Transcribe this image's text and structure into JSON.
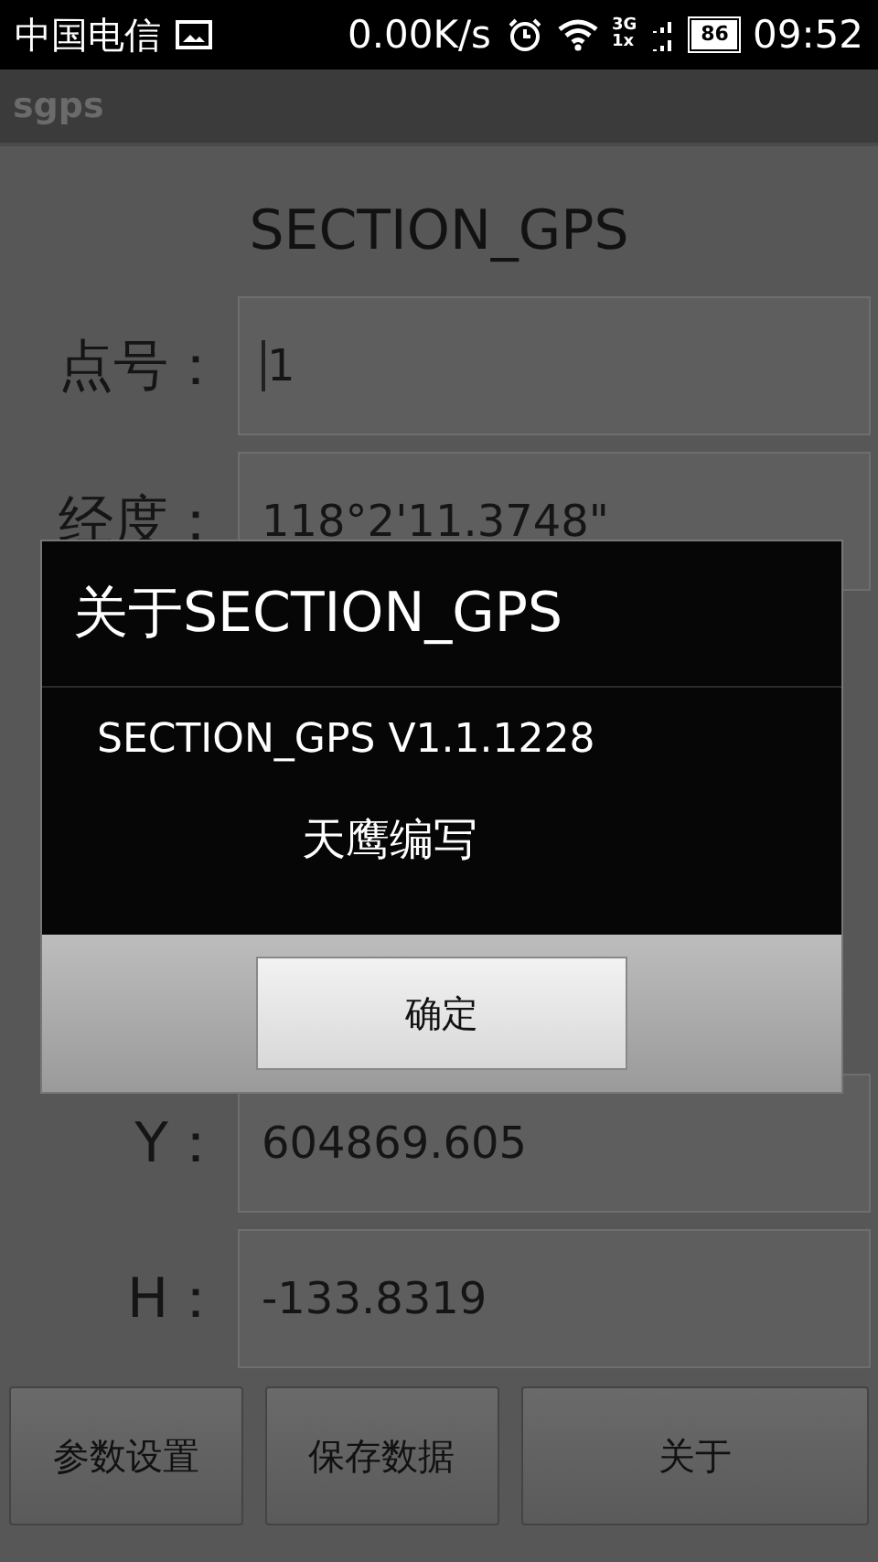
{
  "status_bar": {
    "carrier": "中国电信",
    "speed": "0.00K/s",
    "network_top": "3G",
    "network_bottom": "1x",
    "battery": "86",
    "time": "09:52"
  },
  "app_bar": {
    "title": "sgps"
  },
  "heading": "SECTION_GPS",
  "upper_rows": [
    {
      "label": "点号：",
      "value": "1",
      "focused": true
    },
    {
      "label": "经度：",
      "value": "118°2'11.3748\"",
      "focused": false
    }
  ],
  "lower_rows": [
    {
      "label": "Y：",
      "value": "604869.605",
      "focused": false
    },
    {
      "label": "H：",
      "value": "-133.8319",
      "focused": false
    }
  ],
  "buttons": [
    {
      "label": "参数设置"
    },
    {
      "label": "保存数据"
    },
    {
      "label": "关于"
    }
  ],
  "dialog": {
    "title": "关于SECTION_GPS",
    "version": "SECTION_GPS V1.1.1228",
    "author": "天鹰编写",
    "ok": "确定"
  }
}
